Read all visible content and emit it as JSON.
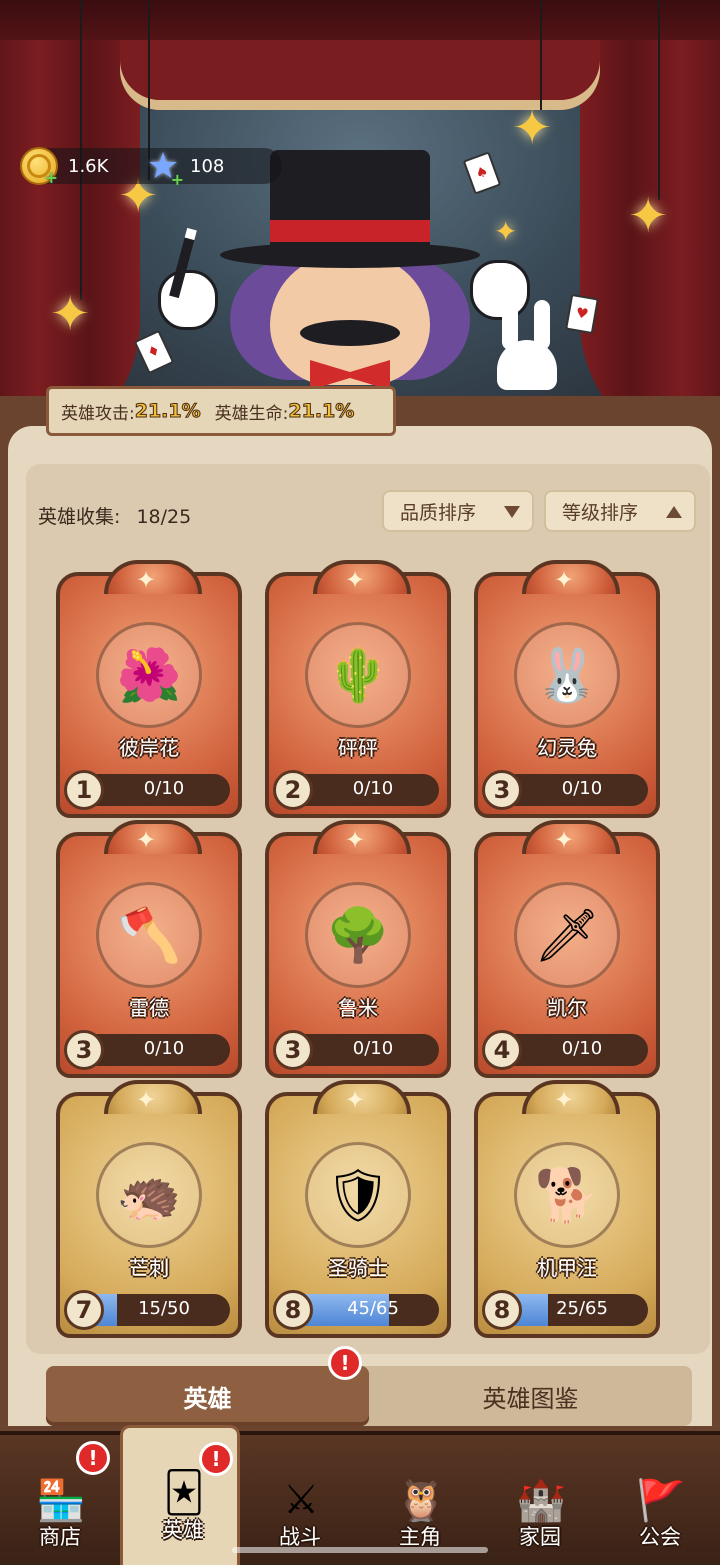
{
  "currency": {
    "gold": "1.6K",
    "gems": "108"
  },
  "bonus": {
    "attack_label": "英雄攻击:",
    "attack_value": "21.1%",
    "hp_label": "英雄生命:",
    "hp_value": "21.1%"
  },
  "collection": {
    "label": "英雄收集:",
    "count": "18/25"
  },
  "sort": {
    "quality": "品质排序",
    "level": "等级排序"
  },
  "heroes": [
    {
      "name": "彼岸花",
      "rank": "1",
      "progress": "0/10",
      "fill": 0,
      "rarity": "red",
      "icon": "flower-hero"
    },
    {
      "name": "砰砰",
      "rank": "2",
      "progress": "0/10",
      "fill": 0,
      "rarity": "red",
      "icon": "cactus-hero"
    },
    {
      "name": "幻灵兔",
      "rank": "3",
      "progress": "0/10",
      "fill": 0,
      "rarity": "red",
      "icon": "rabbit-hero"
    },
    {
      "name": "雷德",
      "rank": "3",
      "progress": "0/10",
      "fill": 0,
      "rarity": "red",
      "icon": "viking-hero"
    },
    {
      "name": "鲁米",
      "rank": "3",
      "progress": "0/10",
      "fill": 0,
      "rarity": "red",
      "icon": "tree-hero"
    },
    {
      "name": "凯尔",
      "rank": "4",
      "progress": "0/10",
      "fill": 0,
      "rarity": "red",
      "icon": "archer-hero"
    },
    {
      "name": "芒刺",
      "rank": "7",
      "progress": "15/50",
      "fill": 0.3,
      "rarity": "gold",
      "icon": "spike-hero"
    },
    {
      "name": "圣骑士",
      "rank": "8",
      "progress": "45/65",
      "fill": 0.69,
      "rarity": "gold",
      "icon": "paladin-hero"
    },
    {
      "name": "机甲汪",
      "rank": "8",
      "progress": "25/65",
      "fill": 0.38,
      "rarity": "gold",
      "icon": "mech-dog-hero"
    }
  ],
  "tabs": {
    "heroes": "英雄",
    "codex": "英雄图鉴"
  },
  "nav": [
    {
      "label": "商店",
      "icon": "shop-icon",
      "alert": true
    },
    {
      "label": "英雄",
      "icon": "hero-cards-icon",
      "alert": true,
      "active": true
    },
    {
      "label": "战斗",
      "icon": "battle-icon"
    },
    {
      "label": "主角",
      "icon": "protagonist-icon"
    },
    {
      "label": "家园",
      "icon": "castle-icon"
    },
    {
      "label": "公会",
      "icon": "guild-icon"
    }
  ]
}
